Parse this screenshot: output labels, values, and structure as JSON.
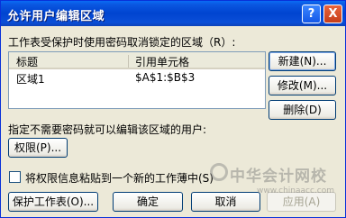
{
  "window": {
    "title": "允许用户编辑区域",
    "help_glyph": "?",
    "close_glyph": "X"
  },
  "intro_label": "工作表受保护时使用密码取消锁定的区域（R）:",
  "ranges_list": {
    "columns": [
      "标题",
      "引用单元格"
    ],
    "rows": [
      {
        "title": "区域1",
        "refers_to": "$A$1:$B$3"
      }
    ]
  },
  "side_buttons": {
    "new": "新建(N)...",
    "modify": "修改(M)...",
    "delete": "删除(D)"
  },
  "permission_label": "指定不需要密码就可以编辑该区域的用户:",
  "permissions_button": "权限(P)...",
  "paste_checkbox": {
    "label": "将权限信息粘贴到一个新的工作薄中(S)",
    "checked": false
  },
  "bottom_buttons": {
    "protect_sheet": "保护工作表(O)...",
    "ok": "确定",
    "cancel": "取消",
    "apply": "应用(A)"
  },
  "watermark": {
    "text": "中华会计网校",
    "url": "www.chinaacc.com"
  }
}
